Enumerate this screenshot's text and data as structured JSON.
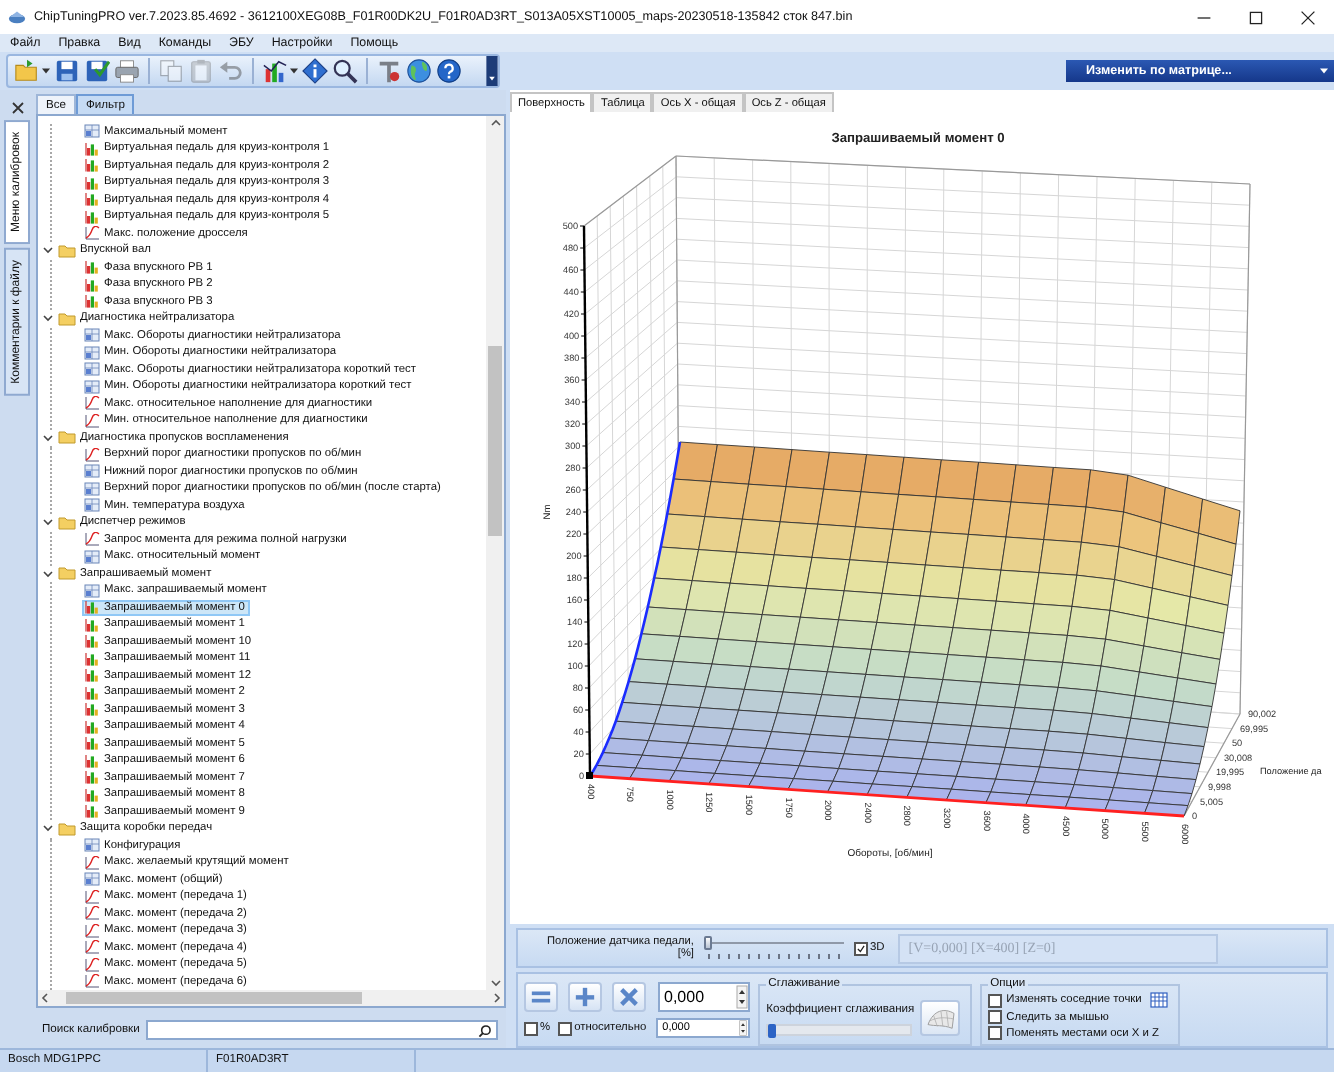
{
  "window": {
    "title": "ChipTuningPRO ver.7.2023.85.4692 - 3612100XEG08B_F01R00DK2U_F01R0AD3RT_S013A05XST10005_maps-20230518-135842 сток 847.bin"
  },
  "menu": [
    "Файл",
    "Правка",
    "Вид",
    "Команды",
    "ЭБУ",
    "Настройки",
    "Помощь"
  ],
  "toolbar": [
    [
      {
        "kind": "open",
        "disabled": false
      },
      {
        "kind": "save",
        "disabled": false
      },
      {
        "kind": "save_check",
        "disabled": false
      },
      {
        "kind": "print",
        "disabled": false
      }
    ],
    [
      {
        "kind": "copy",
        "disabled": true
      },
      {
        "kind": "paste",
        "disabled": true
      },
      {
        "kind": "undo",
        "disabled": true
      }
    ],
    [
      {
        "kind": "chart",
        "disabled": false
      },
      {
        "kind": "diamond",
        "disabled": false
      },
      {
        "kind": "zoom",
        "disabled": false
      }
    ],
    [
      {
        "kind": "tool",
        "disabled": false
      },
      {
        "kind": "globe",
        "disabled": false
      },
      {
        "kind": "help",
        "disabled": false
      }
    ]
  ],
  "matrix_dropdown": {
    "label": "Изменить по матрице..."
  },
  "side_tabs": [
    {
      "label": "Меню калибровок",
      "selected": true
    },
    {
      "label": "Комментарии к файлу",
      "selected": false
    }
  ],
  "tree_tabs": [
    {
      "label": "Все",
      "selected": false
    },
    {
      "label": "Фильтр",
      "selected": true
    }
  ],
  "tree": [
    {
      "children": [
        {
          "label": "Максимальный момент",
          "kind": "table",
          "selected": false
        },
        {
          "label": "Виртуальная педаль для круиз-контроля 1",
          "kind": "map3d",
          "selected": false
        },
        {
          "label": "Виртуальная педаль для круиз-контроля 2",
          "kind": "map3d",
          "selected": false
        },
        {
          "label": "Виртуальная педаль для круиз-контроля 3",
          "kind": "map3d",
          "selected": false
        },
        {
          "label": "Виртуальная педаль для круиз-контроля 4",
          "kind": "map3d",
          "selected": false
        },
        {
          "label": "Виртуальная педаль для круиз-контроля 5",
          "kind": "map3d",
          "selected": false
        },
        {
          "label": "Макс. положение дросселя",
          "kind": "curve",
          "selected": false
        }
      ]
    },
    {
      "label": "Впускной вал",
      "expanded": true,
      "children": [
        {
          "label": "Фаза впускного РВ 1",
          "kind": "map3d",
          "selected": false
        },
        {
          "label": "Фаза впускного РВ 2",
          "kind": "map3d",
          "selected": false
        },
        {
          "label": "Фаза впускного РВ 3",
          "kind": "map3d",
          "selected": false
        }
      ]
    },
    {
      "label": "Диагностика нейтрализатора",
      "expanded": true,
      "children": [
        {
          "label": "Макс. Обороты диагностики нейтрализатора",
          "kind": "table",
          "selected": false
        },
        {
          "label": "Мин. Обороты диагностики нейтрализатора",
          "kind": "table",
          "selected": false
        },
        {
          "label": "Макс. Обороты диагностики нейтрализатора короткий тест",
          "kind": "table",
          "selected": false
        },
        {
          "label": "Мин. Обороты диагностики нейтрализатора короткий тест",
          "kind": "table",
          "selected": false
        },
        {
          "label": "Макс. относительное наполнение для диагностики",
          "kind": "curve",
          "selected": false
        },
        {
          "label": "Мин. относительное наполнение для диагностики",
          "kind": "curve",
          "selected": false
        }
      ]
    },
    {
      "label": "Диагностика пропусков воспламенения",
      "expanded": true,
      "children": [
        {
          "label": "Верхний порог диагностики пропусков по об/мин",
          "kind": "curve",
          "selected": false
        },
        {
          "label": "Нижний порог диагностики пропусков по об/мин",
          "kind": "table",
          "selected": false
        },
        {
          "label": "Верхний порог диагностики пропусков по об/мин (после старта)",
          "kind": "table",
          "selected": false
        },
        {
          "label": "Мин. температура воздуха",
          "kind": "table",
          "selected": false
        }
      ]
    },
    {
      "label": "Диспетчер режимов",
      "expanded": true,
      "children": [
        {
          "label": "Запрос момента для режима полной нагрузки",
          "kind": "curve",
          "selected": false
        },
        {
          "label": "Макс. относительный момент",
          "kind": "table",
          "selected": false
        }
      ]
    },
    {
      "label": "Запрашиваемый момент",
      "expanded": true,
      "children": [
        {
          "label": "Макс. запрашиваемый момент",
          "kind": "table",
          "selected": false
        },
        {
          "label": "Запрашиваемый момент 0",
          "kind": "map3d",
          "selected": true
        },
        {
          "label": "Запрашиваемый момент 1",
          "kind": "map3d",
          "selected": false
        },
        {
          "label": "Запрашиваемый момент 10",
          "kind": "map3d",
          "selected": false
        },
        {
          "label": "Запрашиваемый момент 11",
          "kind": "map3d",
          "selected": false
        },
        {
          "label": "Запрашиваемый момент 12",
          "kind": "map3d",
          "selected": false
        },
        {
          "label": "Запрашиваемый момент 2",
          "kind": "map3d",
          "selected": false
        },
        {
          "label": "Запрашиваемый момент 3",
          "kind": "map3d",
          "selected": false
        },
        {
          "label": "Запрашиваемый момент 4",
          "kind": "map3d",
          "selected": false
        },
        {
          "label": "Запрашиваемый момент 5",
          "kind": "map3d",
          "selected": false
        },
        {
          "label": "Запрашиваемый момент 6",
          "kind": "map3d",
          "selected": false
        },
        {
          "label": "Запрашиваемый момент 7",
          "kind": "map3d",
          "selected": false
        },
        {
          "label": "Запрашиваемый момент 8",
          "kind": "map3d",
          "selected": false
        },
        {
          "label": "Запрашиваемый момент 9",
          "kind": "map3d",
          "selected": false
        }
      ]
    },
    {
      "label": "Защита коробки передач",
      "expanded": true,
      "children": [
        {
          "label": "Конфигурация",
          "kind": "table",
          "selected": false
        },
        {
          "label": "Макс. желаемый крутящий момент",
          "kind": "curve",
          "selected": false
        },
        {
          "label": "Макс. момент (общий)",
          "kind": "table",
          "selected": false
        },
        {
          "label": "Макс. момент (передача 1)",
          "kind": "curve",
          "selected": false
        },
        {
          "label": "Макс. момент (передача 2)",
          "kind": "curve",
          "selected": false
        },
        {
          "label": "Макс. момент (передача 3)",
          "kind": "curve",
          "selected": false
        },
        {
          "label": "Макс. момент (передача 4)",
          "kind": "curve",
          "selected": false
        },
        {
          "label": "Макс. момент (передача 5)",
          "kind": "curve",
          "selected": false
        },
        {
          "label": "Макс. момент (передача 6)",
          "kind": "curve",
          "selected": false
        }
      ]
    }
  ],
  "search": {
    "label": "Поиск калибровки"
  },
  "view_tabs": [
    {
      "label": "Поверхность",
      "selected": true
    },
    {
      "label": "Таблица",
      "selected": false
    },
    {
      "label": "Ось X - общая",
      "selected": false
    },
    {
      "label": "Ось Z - общая",
      "selected": false
    }
  ],
  "surface_chart": {
    "title": "Запрашиваемый момент 0",
    "ylabel": "Nm",
    "xlabel": "Обороты, [об/мин]",
    "zlabel": "Положение да",
    "yticks": [
      "500",
      "480",
      "460",
      "440",
      "420",
      "400",
      "380",
      "360",
      "340",
      "320",
      "300",
      "280",
      "260",
      "240",
      "220",
      "200",
      "180",
      "160",
      "140",
      "120",
      "100",
      "80",
      "60",
      "40",
      "20",
      "0"
    ],
    "xticks": [
      "400",
      "750",
      "1000",
      "1250",
      "1500",
      "1750",
      "2000",
      "2400",
      "2800",
      "3200",
      "3600",
      "4000",
      "4500",
      "5000",
      "5500",
      "6000"
    ],
    "zticks": [
      "90,002",
      "69,995",
      "50",
      "30,008",
      "19,995",
      "9,998",
      "5,005",
      "0"
    ]
  },
  "pedal": {
    "label": "Положение датчика педали, [%]",
    "level": 0,
    "three_d": {
      "label": "3D",
      "checked": true
    },
    "readout": "[V=0,000] [X=400] [Z=0]"
  },
  "edit": {
    "buttons": [
      {
        "kind": "equals"
      },
      {
        "kind": "plus"
      },
      {
        "kind": "multiply"
      }
    ],
    "value": "0,000",
    "percent": {
      "label": "%",
      "checked": false
    },
    "relative": {
      "label": "относительно",
      "checked": false
    },
    "step": "0,000"
  },
  "smoothing": {
    "title": "Сглаживание",
    "label": "Коэффициент сглаживания",
    "level": 0
  },
  "options": {
    "title": "Опции",
    "items": [
      {
        "label": "Изменять соседние точки",
        "checked": false,
        "grid_button": true
      },
      {
        "label": "Следить за мышью",
        "checked": false,
        "grid_button": false
      },
      {
        "label": "Поменять местами оси X и Z",
        "checked": false,
        "grid_button": false
      }
    ]
  },
  "status_bar": [
    "Bosch MDG1PPC",
    "F01R0AD3RT"
  ]
}
